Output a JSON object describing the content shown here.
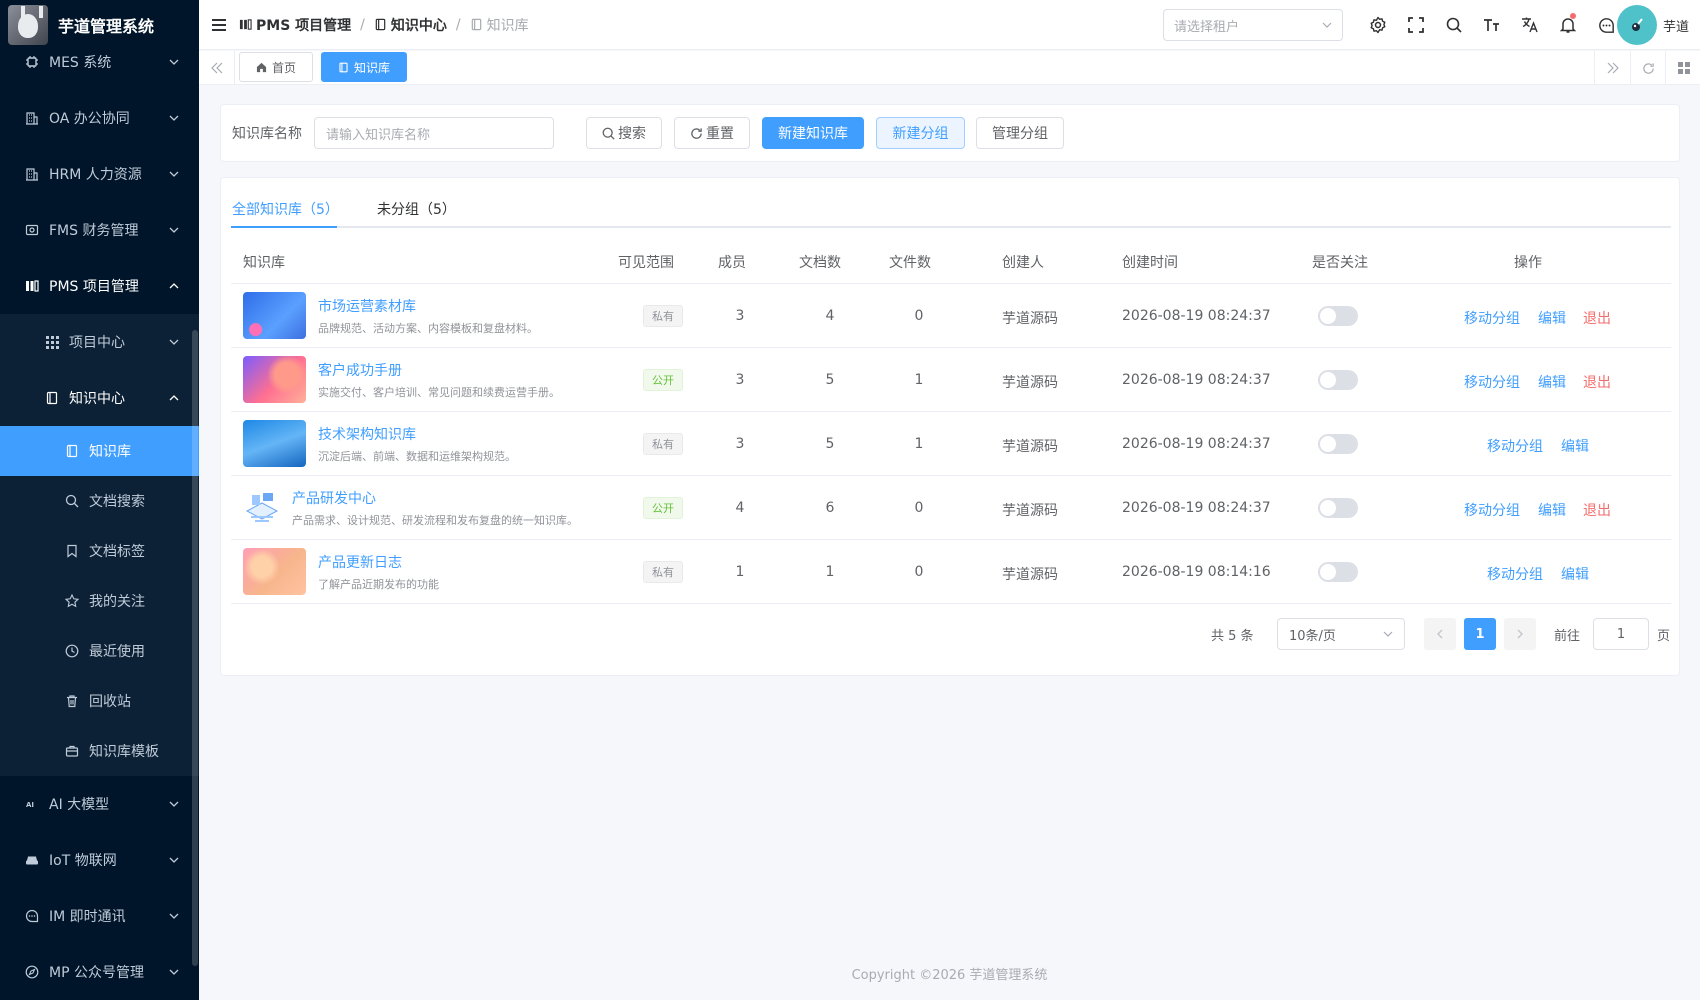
{
  "app": {
    "title": "芋道管理系统"
  },
  "sidebar": {
    "items": [
      {
        "label": "MES 系统"
      },
      {
        "label": "OA 办公协同"
      },
      {
        "label": "HRM 人力资源"
      },
      {
        "label": "FMS 财务管理"
      },
      {
        "label": "PMS 项目管理"
      },
      {
        "label": "项目中心"
      },
      {
        "label": "知识中心"
      },
      {
        "label": "知识库"
      },
      {
        "label": "文档搜索"
      },
      {
        "label": "文档标签"
      },
      {
        "label": "我的关注"
      },
      {
        "label": "最近使用"
      },
      {
        "label": "回收站"
      },
      {
        "label": "知识库模板"
      },
      {
        "label": "AI 大模型"
      },
      {
        "label": "IoT 物联网"
      },
      {
        "label": "IM 即时通讯"
      },
      {
        "label": "MP 公众号管理"
      }
    ]
  },
  "header": {
    "breadcrumb": [
      "PMS 项目管理",
      "知识中心",
      "知识库"
    ],
    "tenant_placeholder": "请选择租户",
    "user_name": "芋道"
  },
  "tags": {
    "home": "首页",
    "current": "知识库"
  },
  "search": {
    "label": "知识库名称",
    "placeholder": "请输入知识库名称",
    "search_btn": "搜索",
    "reset_btn": "重置",
    "new_kb_btn": "新建知识库",
    "new_group_btn": "新建分组",
    "manage_group_btn": "管理分组"
  },
  "tabs": {
    "all": "全部知识库（5）",
    "ungrouped": "未分组（5）"
  },
  "table": {
    "headers": [
      "知识库",
      "可见范围",
      "成员",
      "文档数",
      "文件数",
      "创建人",
      "创建时间",
      "是否关注",
      "操作"
    ],
    "rows": [
      {
        "name": "市场运营素材库",
        "desc": "品牌规范、活动方案、内容模板和复盘材料。",
        "scope": "私有",
        "members": "3",
        "docs": "4",
        "files": "0",
        "creator": "芋道源码",
        "time": "2026-08-19 08:24:37",
        "ops": [
          "移动分组",
          "编辑",
          "退出"
        ]
      },
      {
        "name": "客户成功手册",
        "desc": "实施交付、客户培训、常见问题和续费运营手册。",
        "scope": "公开",
        "members": "3",
        "docs": "5",
        "files": "1",
        "creator": "芋道源码",
        "time": "2026-08-19 08:24:37",
        "ops": [
          "移动分组",
          "编辑",
          "退出"
        ]
      },
      {
        "name": "技术架构知识库",
        "desc": "沉淀后端、前端、数据和运维架构规范。",
        "scope": "私有",
        "members": "3",
        "docs": "5",
        "files": "1",
        "creator": "芋道源码",
        "time": "2026-08-19 08:24:37",
        "ops": [
          "移动分组",
          "编辑"
        ]
      },
      {
        "name": "产品研发中心",
        "desc": "产品需求、设计规范、研发流程和发布复盘的统一知识库。",
        "scope": "公开",
        "members": "4",
        "docs": "6",
        "files": "0",
        "creator": "芋道源码",
        "time": "2026-08-19 08:24:37",
        "ops": [
          "移动分组",
          "编辑",
          "退出"
        ]
      },
      {
        "name": "产品更新日志",
        "desc": "了解产品近期发布的功能",
        "scope": "私有",
        "members": "1",
        "docs": "1",
        "files": "0",
        "creator": "芋道源码",
        "time": "2026-08-19 08:14:16",
        "ops": [
          "移动分组",
          "编辑"
        ]
      }
    ]
  },
  "pagination": {
    "total": "共 5 条",
    "page_size": "10条/页",
    "current_page": "1",
    "goto_label": "前往",
    "goto_value": "1",
    "page_suffix": "页"
  },
  "footer": {
    "copyright": "Copyright ©2026 芋道管理系统"
  },
  "colors": {
    "primary": "#409eff",
    "danger": "#f56c6c",
    "success": "#67c23a",
    "sidebar_bg": "#001529"
  }
}
